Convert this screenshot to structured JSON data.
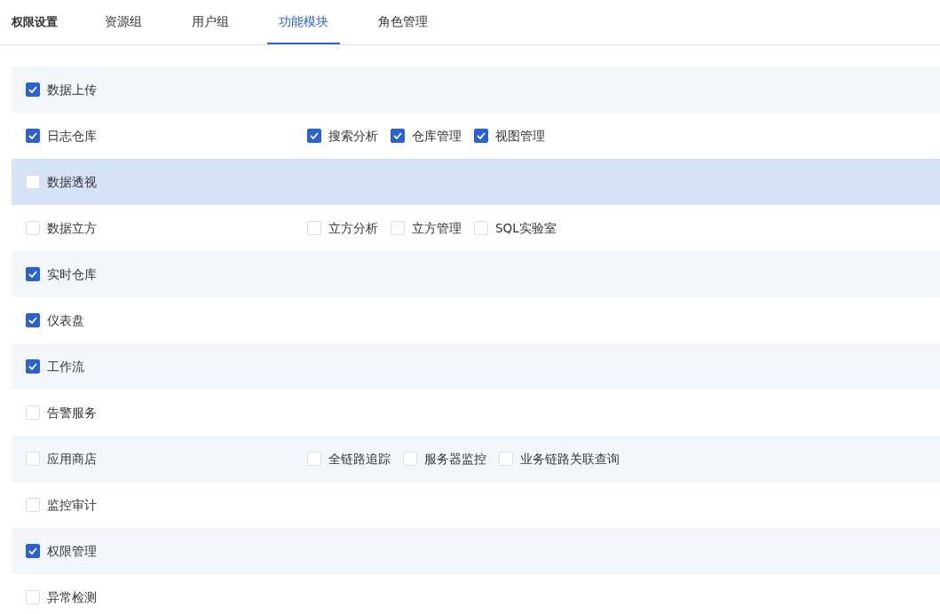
{
  "header": {
    "title": "权限设置",
    "tabs": [
      {
        "label": "资源组",
        "selected": false
      },
      {
        "label": "用户组",
        "selected": false
      },
      {
        "label": "功能模块",
        "selected": true
      },
      {
        "label": "角色管理",
        "selected": false
      }
    ]
  },
  "modules": [
    {
      "label": "数据上传",
      "checked": true,
      "highlighted": false
    },
    {
      "label": "日志仓库",
      "checked": true,
      "highlighted": false,
      "children": [
        {
          "label": "搜索分析",
          "checked": true
        },
        {
          "label": "仓库管理",
          "checked": true
        },
        {
          "label": "视图管理",
          "checked": true
        }
      ]
    },
    {
      "label": "数据透视",
      "checked": false,
      "highlighted": true
    },
    {
      "label": "数据立方",
      "checked": false,
      "highlighted": false,
      "children": [
        {
          "label": "立方分析",
          "checked": false
        },
        {
          "label": "立方管理",
          "checked": false
        },
        {
          "label": "SQL实验室",
          "checked": false
        }
      ]
    },
    {
      "label": "实时仓库",
      "checked": true,
      "highlighted": false
    },
    {
      "label": "仪表盘",
      "checked": true,
      "highlighted": false
    },
    {
      "label": "工作流",
      "checked": true,
      "highlighted": false
    },
    {
      "label": "告警服务",
      "checked": false,
      "highlighted": false
    },
    {
      "label": "应用商店",
      "checked": false,
      "highlighted": false,
      "children": [
        {
          "label": "全链路追踪",
          "checked": false
        },
        {
          "label": "服务器监控",
          "checked": false
        },
        {
          "label": "业务链路关联查询",
          "checked": false
        }
      ]
    },
    {
      "label": "监控审计",
      "checked": false,
      "highlighted": false
    },
    {
      "label": "权限管理",
      "checked": true,
      "highlighted": false
    },
    {
      "label": "异常检测",
      "checked": false,
      "highlighted": false
    }
  ]
}
